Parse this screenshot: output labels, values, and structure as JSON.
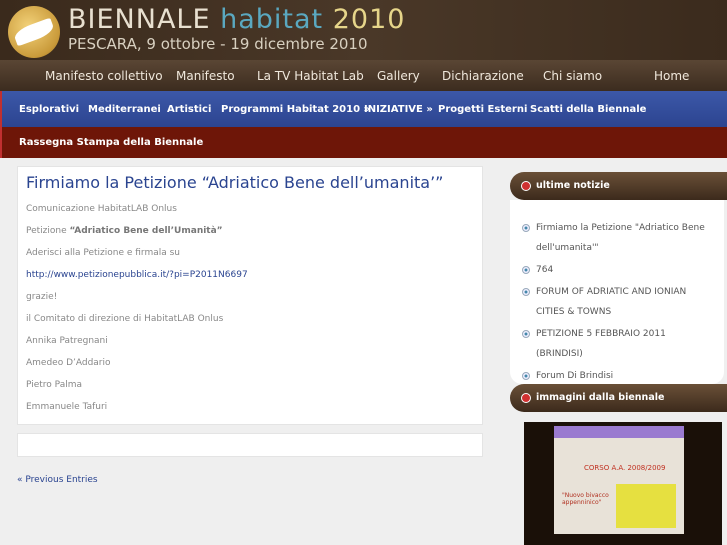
{
  "header": {
    "title_a": "BIENNALE",
    "title_b": "habitat",
    "title_c": "2010",
    "subtitle": "PESCARA, 9 ottobre - 19 dicembre 2010"
  },
  "topnav": [
    "Manifesto collettivo",
    "Manifesto",
    "La TV Habitat Lab",
    "Gallery",
    "Dichiarazione",
    "Chi siamo",
    "Home"
  ],
  "bluenav": [
    "Esplorativi",
    "Mediterranei",
    "Artistici",
    "Programmi Habitat 2010 »",
    "INIZIATIVE »",
    "Progetti Esterni",
    "Scatti della Biennale"
  ],
  "rednav": [
    "Rassegna Stampa della Biennale"
  ],
  "post": {
    "title": "Firmiamo la Petizione “Adriatico Bene dell’umanita’”",
    "line1": "Comunicazione HabitatLAB Onlus",
    "pet_label": "Petizione ",
    "pet_bold": "“Adriatico Bene dell’Umanità”",
    "line3": "Aderisci alla Petizione e firmala su",
    "link": "http://www.petizionepubblica.it/?pi=P2011N6697",
    "line5": "grazie!",
    "line6": "il Comitato di direzione di HabitatLAB Onlus",
    "names": [
      "Annika Patregnani",
      "Amedeo D’Addario",
      "Pietro Palma",
      "Emmanuele Tafuri"
    ]
  },
  "prev_entries": "« Previous Entries",
  "sidebar": {
    "news_title": "ultime notizie",
    "news": [
      "Firmiamo la Petizione \"Adriatico Bene dell'umanita'\"",
      "764",
      "FORUM OF ADRIATIC AND IONIAN CITIES & TOWNS",
      "PETIZIONE 5 FEBBRAIO 2011 (BRINDISI)",
      "Forum Di Brindisi"
    ],
    "images_title": "immagini dalla biennale",
    "photo_text": {
      "course": "CORSO A.A. 2008/2009",
      "caption": "\"Nuovo bivacco appenninico\""
    }
  }
}
